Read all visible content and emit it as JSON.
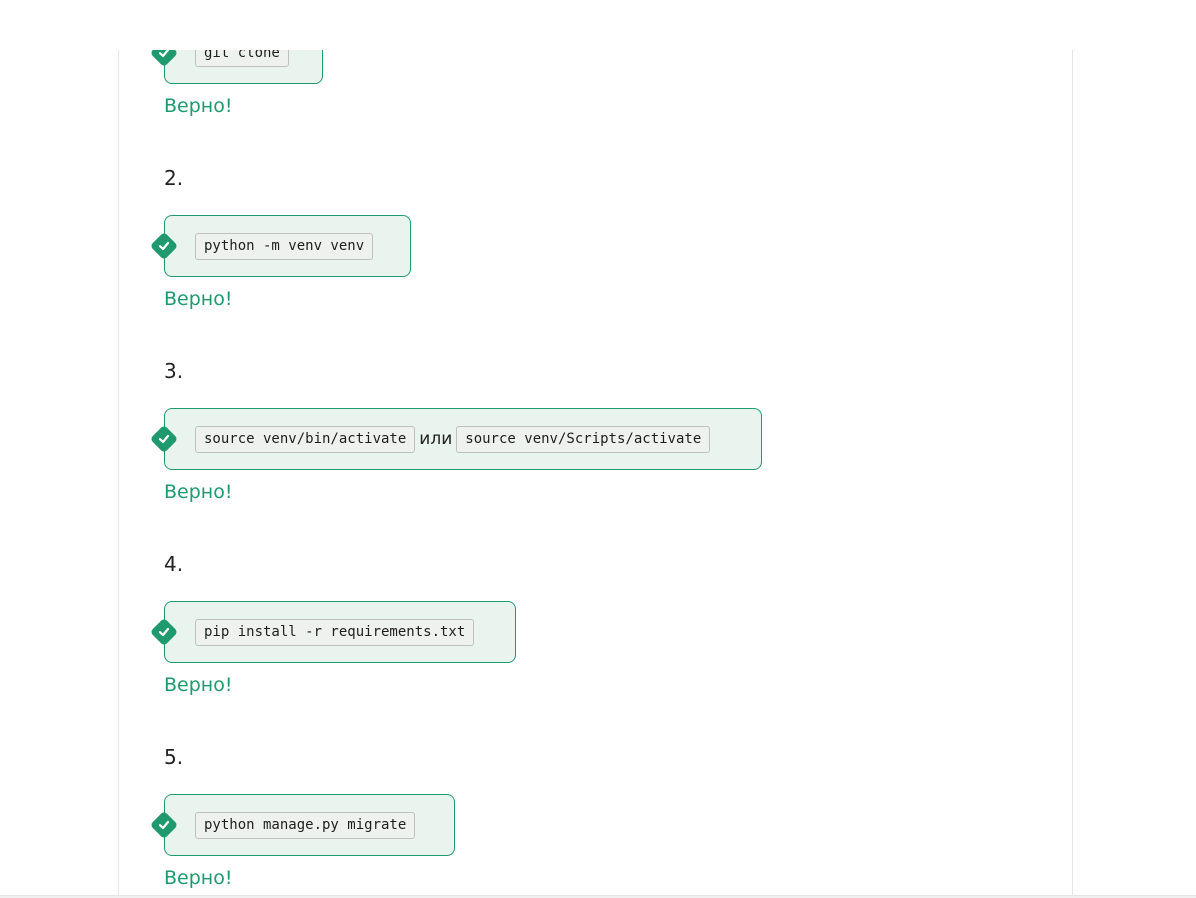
{
  "steps": [
    {
      "number": "",
      "commands": [
        "git clone"
      ],
      "feedback": "Верно!"
    },
    {
      "number": "2.",
      "commands": [
        "python -m venv venv"
      ],
      "feedback": "Верно!"
    },
    {
      "number": "3.",
      "commands": [
        "source venv/bin/activate",
        "source venv/Scripts/activate"
      ],
      "separator": "или",
      "feedback": "Верно!"
    },
    {
      "number": "4.",
      "commands": [
        "pip install -r requirements.txt"
      ],
      "feedback": "Верно!"
    },
    {
      "number": "5.",
      "commands": [
        "python manage.py migrate"
      ],
      "feedback": "Верно!"
    }
  ],
  "colors": {
    "accent": "#1f9a6e",
    "box_bg": "#e9f4ef",
    "code_bg": "#eef2ef"
  },
  "icons": {
    "check": "check-icon"
  }
}
